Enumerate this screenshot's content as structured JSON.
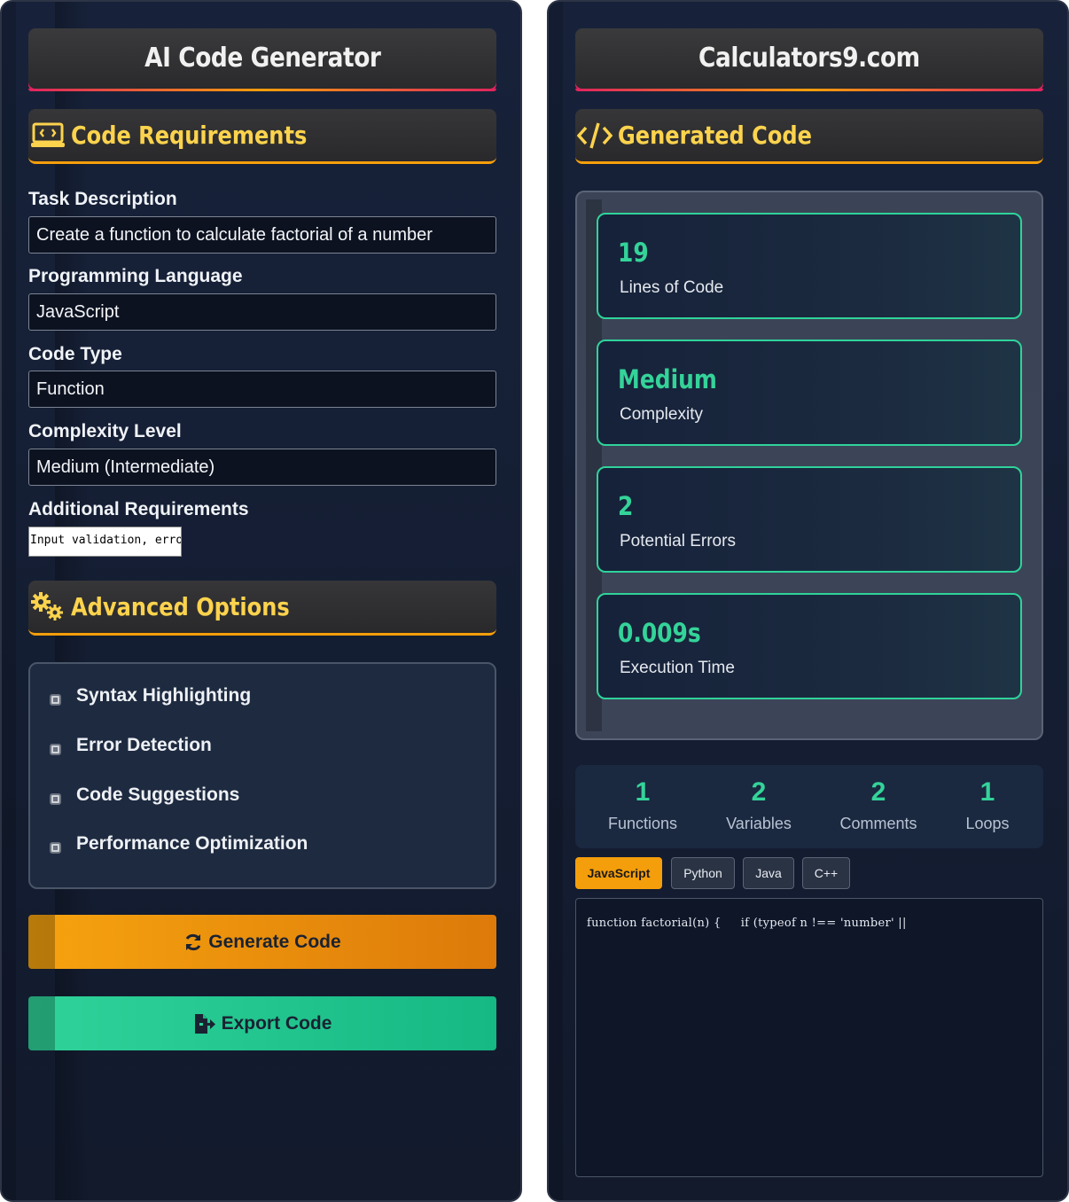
{
  "left": {
    "title": "AI Code Generator",
    "requirements_heading": "Code Requirements",
    "task_label": "Task Description",
    "task_value": "Create a function to calculate factorial of a number",
    "language_label": "Programming Language",
    "language_value": "JavaScript",
    "code_type_label": "Code Type",
    "code_type_value": "Function",
    "complexity_label": "Complexity Level",
    "complexity_value": "Medium (Intermediate)",
    "additional_label": "Additional Requirements",
    "additional_value": "Input validation, erro",
    "advanced_heading": "Advanced Options",
    "options": [
      {
        "label": "Syntax Highlighting"
      },
      {
        "label": "Error Detection"
      },
      {
        "label": "Code Suggestions"
      },
      {
        "label": "Performance Optimization"
      }
    ],
    "generate_label": "Generate Code",
    "export_label": "Export Code"
  },
  "right": {
    "title": "Calculators9.com",
    "generated_heading": "Generated Code",
    "stats": [
      {
        "value": "19",
        "caption": "Lines of Code"
      },
      {
        "value": "Medium",
        "caption": "Complexity"
      },
      {
        "value": "2",
        "caption": "Potential Errors"
      },
      {
        "value": "0.009s",
        "caption": "Execution Time"
      }
    ],
    "metrics": [
      {
        "value": "1",
        "label": "Functions"
      },
      {
        "value": "2",
        "label": "Variables"
      },
      {
        "value": "2",
        "label": "Comments"
      },
      {
        "value": "1",
        "label": "Loops"
      }
    ],
    "languages": [
      "JavaScript",
      "Python",
      "Java",
      "C++"
    ],
    "active_language": "JavaScript",
    "code": "function factorial(n) {     if (typeof n !== 'number' ||"
  },
  "colors": {
    "accent_orange": "#f59e0b",
    "accent_green": "#34d399",
    "accent_pink": "#e0245e",
    "heading_yellow": "#fcd34d"
  }
}
